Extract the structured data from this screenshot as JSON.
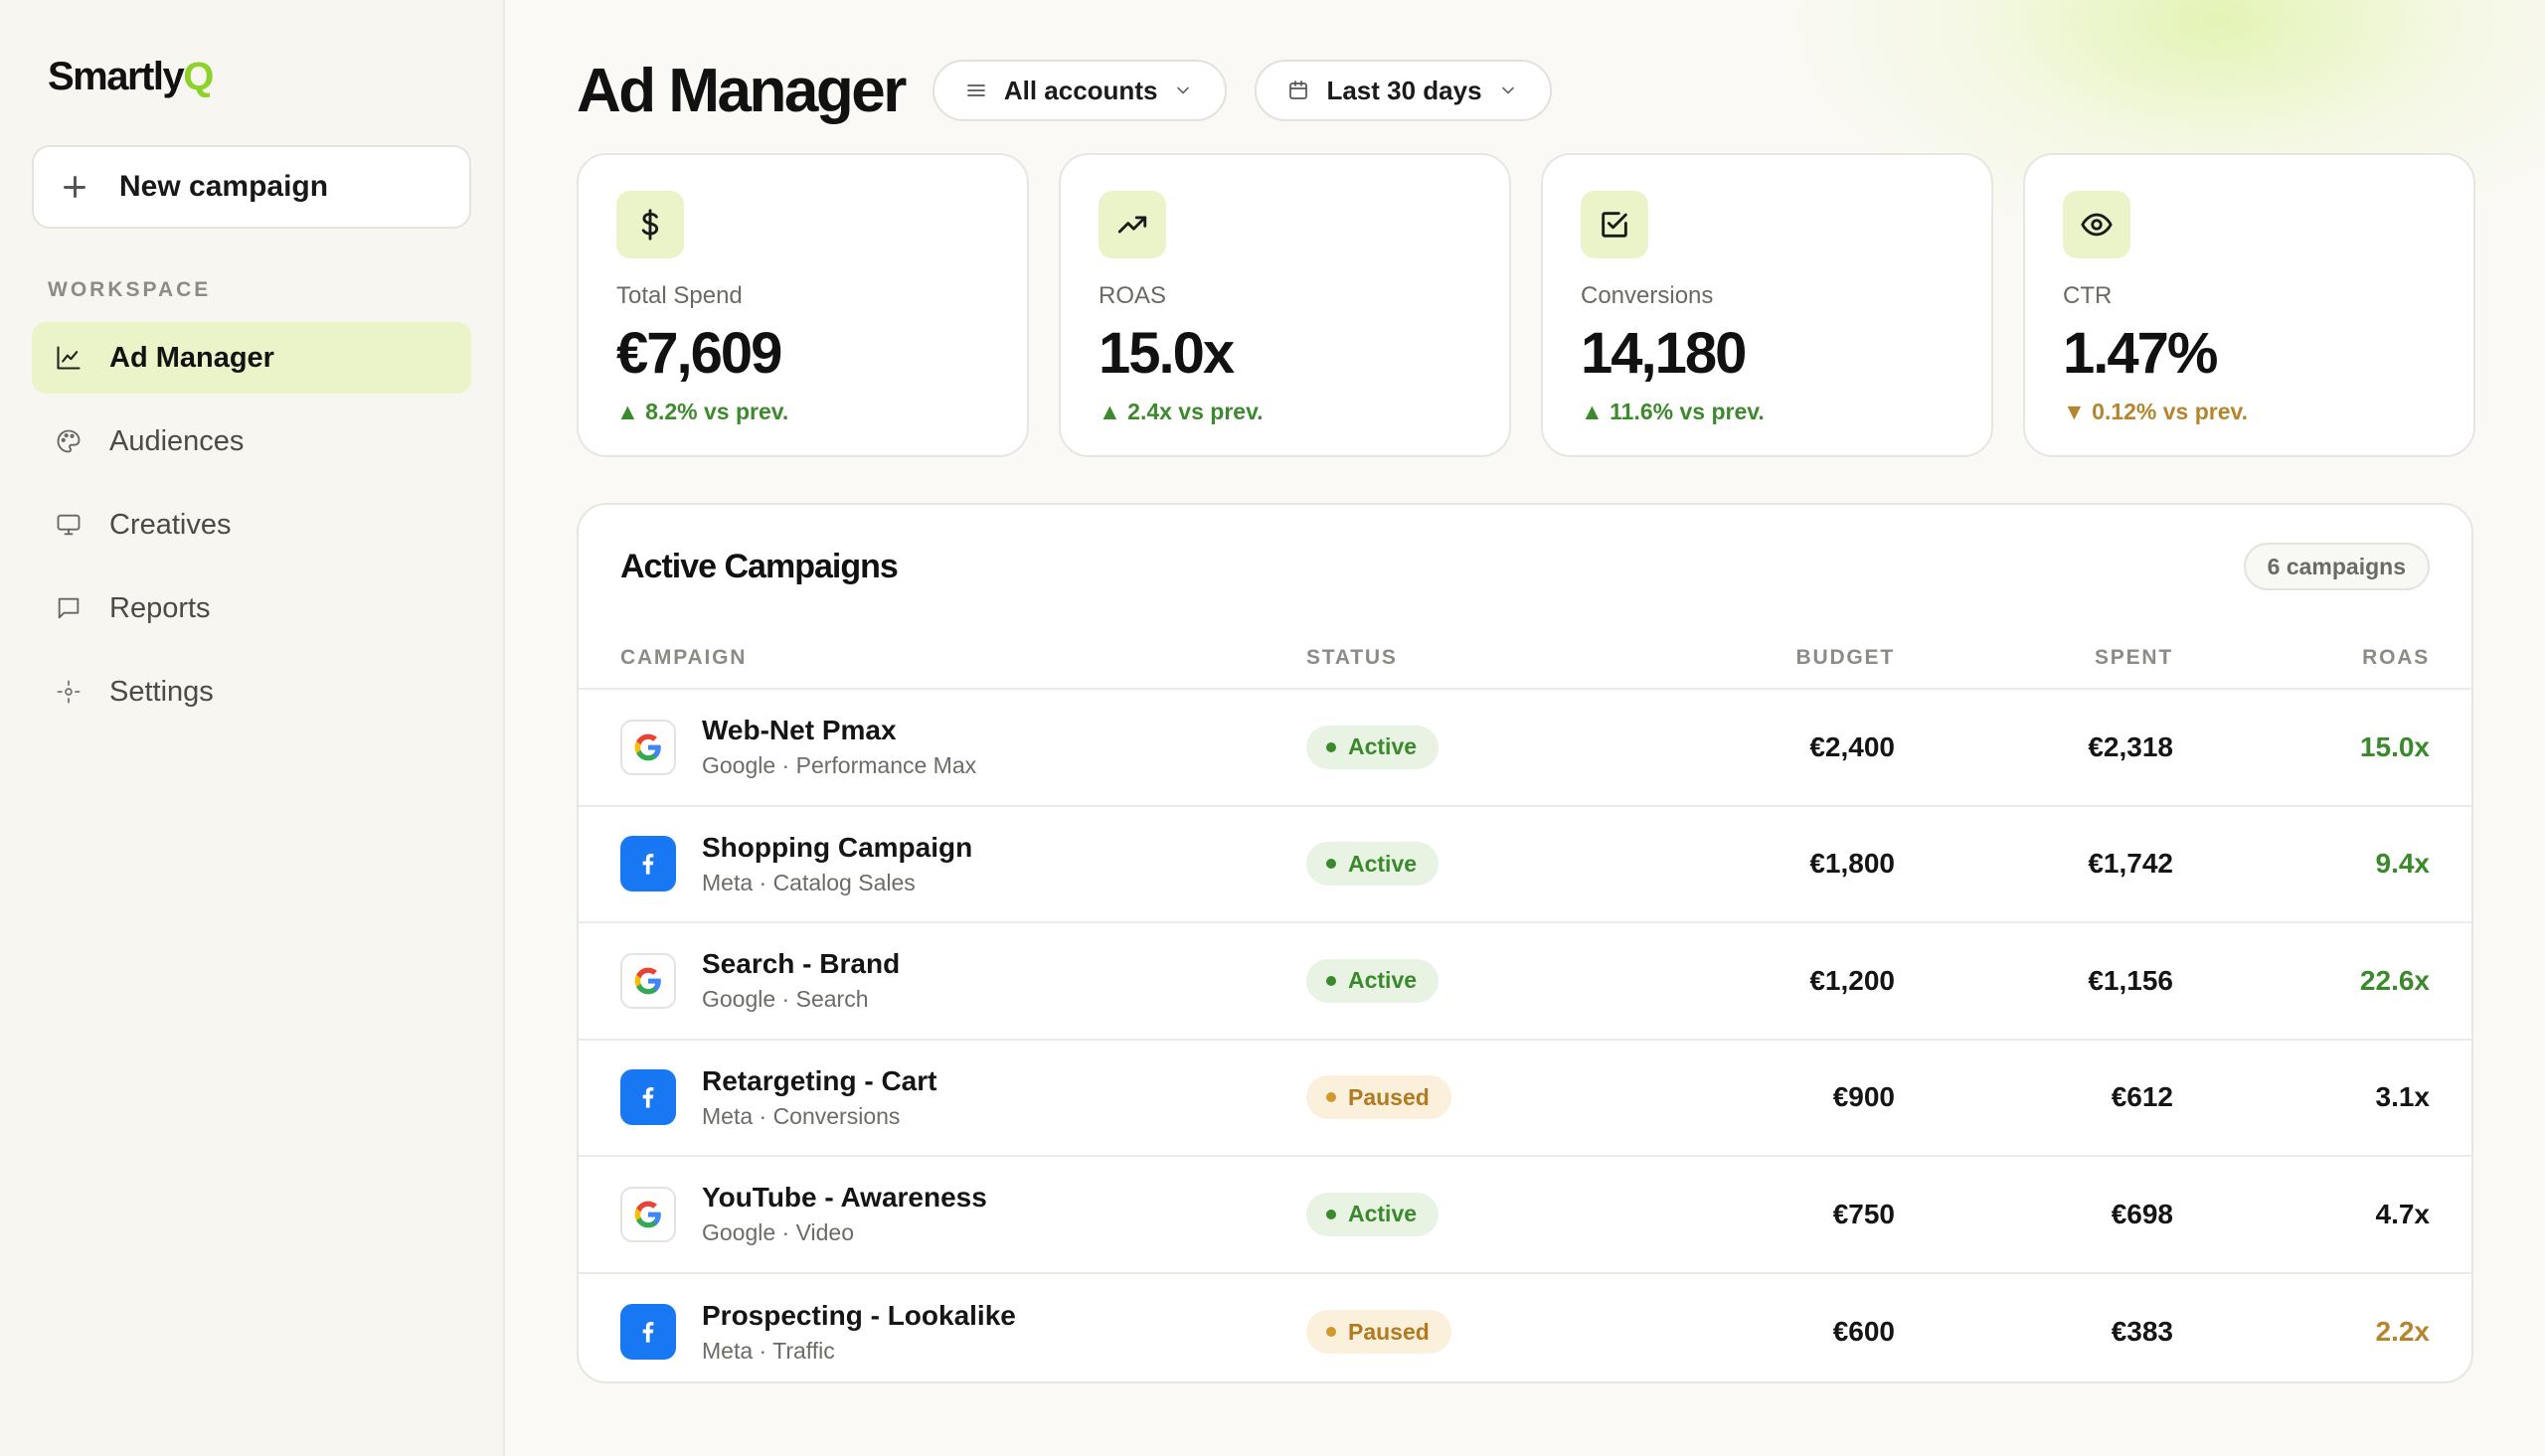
{
  "brand": {
    "name": "Smartly",
    "accent_letter": "Q",
    "accent_color": "#8dd12a"
  },
  "sidebar": {
    "new_campaign_label": "New campaign",
    "section_label": "WORKSPACE",
    "items": [
      {
        "label": "Ad Manager",
        "icon": "chart-line-icon",
        "active": true
      },
      {
        "label": "Audiences",
        "icon": "palette-icon",
        "active": false
      },
      {
        "label": "Creatives",
        "icon": "monitor-icon",
        "active": false
      },
      {
        "label": "Reports",
        "icon": "chat-bubble-icon",
        "active": false
      },
      {
        "label": "Settings",
        "icon": "settings-icon",
        "active": false
      }
    ]
  },
  "header": {
    "title": "Ad Manager",
    "accounts_filter": "All accounts",
    "date_filter": "Last 30 days"
  },
  "kpis": [
    {
      "label": "Total Spend",
      "value": "€7,609",
      "delta": "▲ 8.2% vs prev.",
      "trend": "up",
      "icon": "dollar-icon"
    },
    {
      "label": "ROAS",
      "value": "15.0x",
      "delta": "▲ 2.4x vs prev.",
      "trend": "up",
      "icon": "trending-up-icon"
    },
    {
      "label": "Conversions",
      "value": "14,180",
      "delta": "▲ 11.6% vs prev.",
      "trend": "up",
      "icon": "checkbox-icon"
    },
    {
      "label": "CTR",
      "value": "1.47%",
      "delta": "▼ 0.12% vs prev.",
      "trend": "down",
      "icon": "eye-icon"
    }
  ],
  "campaigns": {
    "title": "Active Campaigns",
    "count_label": "6 campaigns",
    "columns": {
      "campaign": "CAMPAIGN",
      "status": "STATUS",
      "budget": "BUDGET",
      "spent": "SPENT",
      "roas": "ROAS"
    },
    "rows": [
      {
        "name": "Web-Net Pmax",
        "sub": "Google · Performance Max",
        "platform": "google",
        "status": "Active",
        "budget": "€2,400",
        "spent": "€2,318",
        "roas": "15.0x",
        "roas_tone": "good"
      },
      {
        "name": "Shopping Campaign",
        "sub": "Meta · Catalog Sales",
        "platform": "meta",
        "status": "Active",
        "budget": "€1,800",
        "spent": "€1,742",
        "roas": "9.4x",
        "roas_tone": "good"
      },
      {
        "name": "Search - Brand",
        "sub": "Google · Search",
        "platform": "google",
        "status": "Active",
        "budget": "€1,200",
        "spent": "€1,156",
        "roas": "22.6x",
        "roas_tone": "good"
      },
      {
        "name": "Retargeting - Cart",
        "sub": "Meta · Conversions",
        "platform": "meta",
        "status": "Paused",
        "budget": "€900",
        "spent": "€612",
        "roas": "3.1x",
        "roas_tone": "neutral"
      },
      {
        "name": "YouTube - Awareness",
        "sub": "Google · Video",
        "platform": "google",
        "status": "Active",
        "budget": "€750",
        "spent": "€698",
        "roas": "4.7x",
        "roas_tone": "neutral"
      },
      {
        "name": "Prospecting - Lookalike",
        "sub": "Meta · Traffic",
        "platform": "meta",
        "status": "Paused",
        "budget": "€600",
        "spent": "€383",
        "roas": "2.2x",
        "roas_tone": "warn"
      }
    ]
  },
  "colors": {
    "accent_light": "#eaf4c8",
    "positive": "#3a8a2c",
    "warning": "#b5852d",
    "meta_blue": "#1877f2"
  }
}
